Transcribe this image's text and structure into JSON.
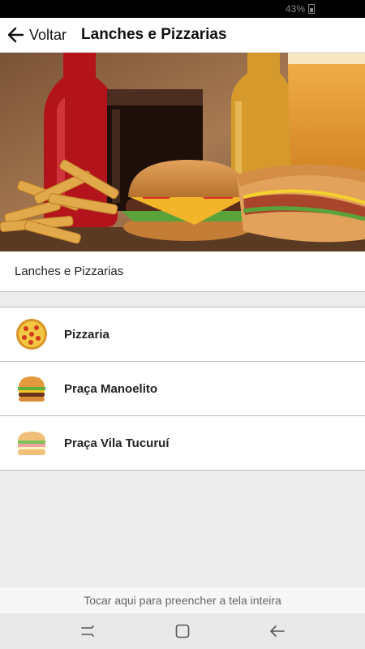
{
  "status_bar": {
    "battery_percent": "43%"
  },
  "top_bar": {
    "back_label": "Voltar",
    "title": "Lanches e Pizzarias",
    "back_icon": "arrow-left-icon"
  },
  "section_header": {
    "label": "Lanches e Pizzarias"
  },
  "list": {
    "items": [
      {
        "label": "Pizzaria",
        "icon": "pizza-icon"
      },
      {
        "label": "Praça Manoelito",
        "icon": "burger-icon"
      },
      {
        "label": "Praça Vila Tucuruí",
        "icon": "sandwich-icon"
      }
    ]
  },
  "fullscreen_prompt": "Tocar aqui para preencher a tela inteira",
  "nav_bar": {
    "icons": [
      "recent-apps-icon",
      "home-icon",
      "back-icon"
    ]
  }
}
